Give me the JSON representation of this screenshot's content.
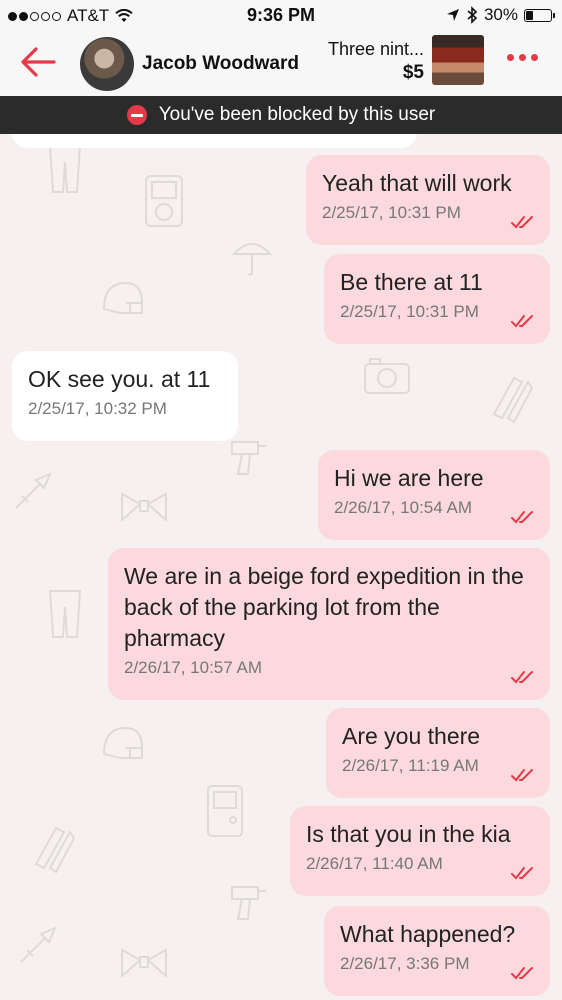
{
  "status_bar": {
    "carrier": "AT&T",
    "time": "9:36 PM",
    "battery": "30%",
    "battery_level": 0.3
  },
  "header": {
    "contact_name": "Jacob Woodward",
    "item_title": "Three nint...",
    "item_price": "$5"
  },
  "banner": {
    "text": "You've been blocked by this user"
  },
  "messages": [
    {
      "direction": "out",
      "text": "Yeah that will work",
      "time": "2/25/17, 10:31 PM"
    },
    {
      "direction": "out",
      "text": "Be there at 11",
      "time": "2/25/17, 10:31 PM"
    },
    {
      "direction": "in",
      "text": "OK see you. at 11",
      "time": "2/25/17, 10:32 PM"
    },
    {
      "direction": "out",
      "text": "Hi we are here",
      "time": "2/26/17, 10:54 AM"
    },
    {
      "direction": "out",
      "text": "We are in a beige ford expedition in the back of the parking lot from the pharmacy",
      "time": "2/26/17, 10:57 AM"
    },
    {
      "direction": "out",
      "text": "Are you there",
      "time": "2/26/17, 11:19 AM"
    },
    {
      "direction": "out",
      "text": "Is that you in the kia",
      "time": "2/26/17, 11:40 AM"
    },
    {
      "direction": "out",
      "text": "What happened?",
      "time": "2/26/17, 3:36 PM"
    }
  ],
  "colors": {
    "accent": "#e5394a",
    "outgoing_bubble": "#fbd9dc",
    "incoming_bubble": "#ffffff",
    "background": "#f6f1f0",
    "banner": "#2b2b2b"
  }
}
